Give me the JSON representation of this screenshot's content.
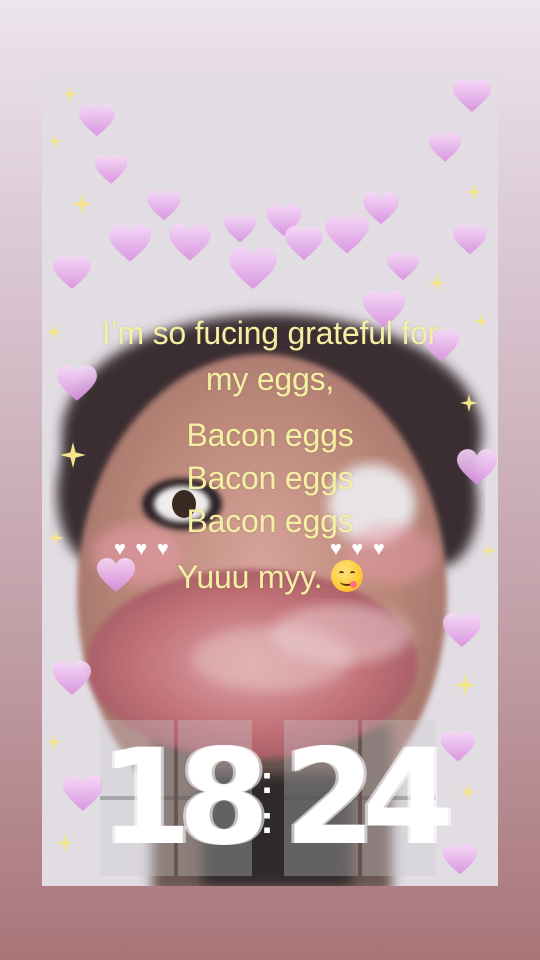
{
  "caption": {
    "line1": "I’m so fucing grateful for",
    "line2": "my eggs,",
    "line3": "Bacon eggs",
    "line4": "Bacon eggs",
    "line5": "Bacon eggs",
    "line6": "Yuuu    myy."
  },
  "clock": {
    "h1": "1",
    "h2": "8",
    "m1": "2",
    "m2": "4"
  },
  "stickers": {
    "left_blush": "♥ ♥ ♥",
    "right_blush": "♥ ♥ ♥",
    "emoji": "yum-face-icon"
  },
  "colors": {
    "caption": "#f3f0a4",
    "heart": "#e7a7ea",
    "clock": "#ffffff"
  }
}
